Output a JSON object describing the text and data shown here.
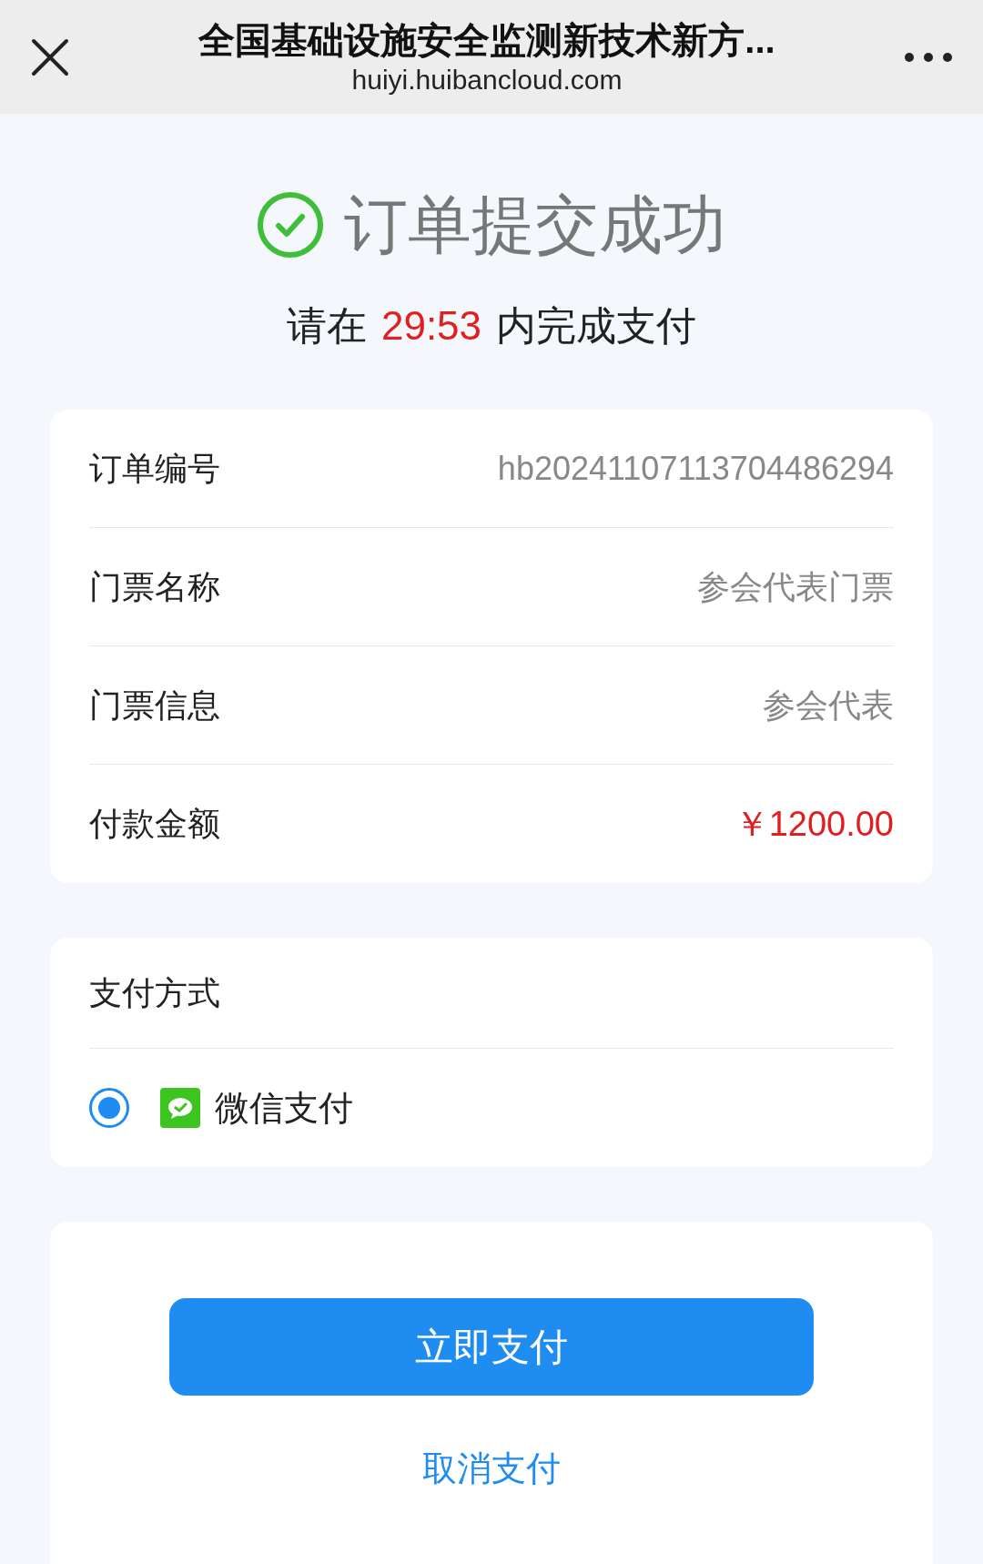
{
  "header": {
    "title": "全国基础设施安全监测新技术新方...",
    "url": "huiyi.huibancloud.com"
  },
  "status": {
    "title": "订单提交成功",
    "countdown_prefix": "请在",
    "countdown": "29:53",
    "countdown_suffix": "内完成支付"
  },
  "order_rows": [
    {
      "label": "订单编号",
      "value": "hb20241107113704486294",
      "kind": "plain"
    },
    {
      "label": "门票名称",
      "value": "参会代表门票",
      "kind": "plain"
    },
    {
      "label": "门票信息",
      "value": "参会代表",
      "kind": "plain"
    },
    {
      "label": "付款金额",
      "value": "￥1200.00",
      "kind": "price"
    }
  ],
  "payment": {
    "title": "支付方式",
    "methods": [
      {
        "label": "微信支付",
        "selected": true
      }
    ]
  },
  "actions": {
    "pay": "立即支付",
    "cancel": "取消支付"
  }
}
